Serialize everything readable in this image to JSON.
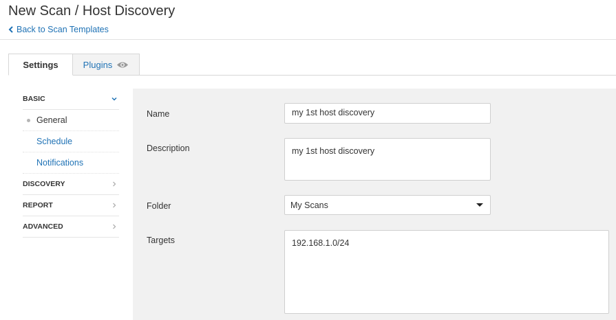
{
  "header": {
    "title": "New Scan / Host Discovery",
    "back_label": "Back to Scan Templates"
  },
  "tabs": [
    {
      "label": "Settings",
      "active": true
    },
    {
      "label": "Plugins",
      "active": false
    }
  ],
  "sidebar": {
    "sections": [
      {
        "label": "BASIC",
        "expanded": true,
        "items": [
          {
            "label": "General",
            "active": true
          },
          {
            "label": "Schedule",
            "active": false
          },
          {
            "label": "Notifications",
            "active": false
          }
        ]
      },
      {
        "label": "DISCOVERY",
        "expanded": false
      },
      {
        "label": "REPORT",
        "expanded": false
      },
      {
        "label": "ADVANCED",
        "expanded": false
      }
    ]
  },
  "form": {
    "name": {
      "label": "Name",
      "value": "my 1st host discovery"
    },
    "description": {
      "label": "Description",
      "value": "my 1st host discovery"
    },
    "folder": {
      "label": "Folder",
      "value": "My Scans"
    },
    "targets": {
      "label": "Targets",
      "value": "192.168.1.0/24"
    }
  },
  "colors": {
    "link": "#1f72b5",
    "panel_bg": "#f1f1f1",
    "border": "#cfcfcf"
  },
  "icons": {
    "back": "chevron-left-icon",
    "plugins": "eye-icon",
    "expanded": "chevron-down-icon",
    "collapsed": "chevron-right-icon",
    "select": "caret-down-icon"
  }
}
